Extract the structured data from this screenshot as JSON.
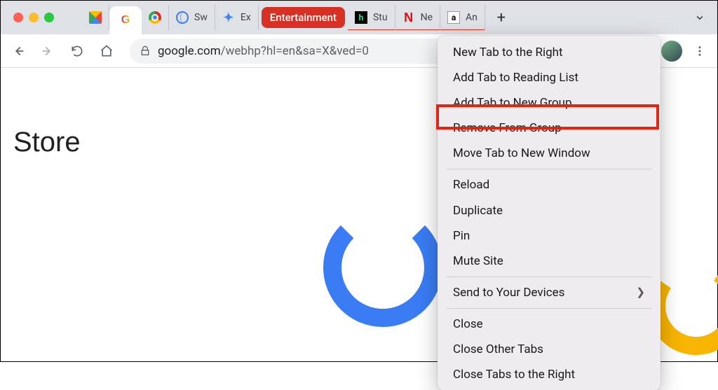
{
  "tabs": {
    "pinned_gmail_title": "",
    "active_title": "",
    "tab_sw": "Sw",
    "tab_ex": "Ex",
    "group_label": "Entertainment",
    "tab_stu": "Stu",
    "tab_ne": "Ne",
    "tab_an": "An"
  },
  "toolbar": {
    "url_host": "google.com",
    "url_path": "/webhp?hl=en&sa=X&ved=0"
  },
  "page": {
    "store_label": "Store"
  },
  "context_menu": {
    "items_group1": [
      "New Tab to the Right",
      "Add Tab to Reading List",
      "Add Tab to New Group",
      "Remove From Group",
      "Move Tab to New Window"
    ],
    "items_group2": [
      "Reload",
      "Duplicate",
      "Pin",
      "Mute Site"
    ],
    "send_label": "Send to Your Devices",
    "items_group3": [
      "Close",
      "Close Other Tabs",
      "Close Tabs to the Right"
    ],
    "highlighted_index": 3
  }
}
